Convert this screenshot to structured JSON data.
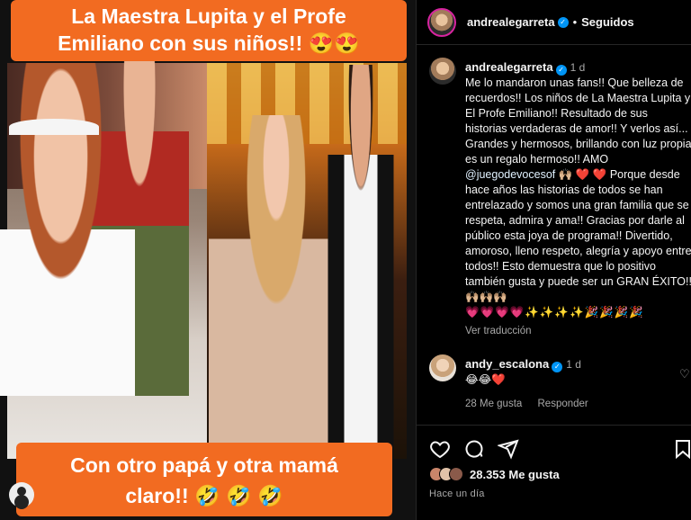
{
  "post_image": {
    "top_banner_line1": "La Maestra Lupita y el Profe",
    "top_banner_line2": "Emiliano con sus niños!! 😍😍",
    "bottom_banner_line1": "Con otro papá y otra mamá",
    "bottom_banner_line2": "claro!! 🤣 🤣 🤣"
  },
  "header": {
    "username": "andrealegarreta",
    "verified": "✓",
    "separator": "•",
    "follow_status": "Seguidos"
  },
  "caption": {
    "username": "andrealegarreta",
    "time": "1 d",
    "text_part1": "Me lo mandaron unas fans!! Que belleza de recuerdos!! Los niños de La Maestra Lupita y El Profe Emiliano!! Resultado de sus historias verdaderas de amor!! Y verlos así... Grandes y hermosos, brillando con luz propia es un regalo hermoso!! AMO ",
    "mention": "@juegodevocesof",
    "text_part2": " 🙌🏼 ❤️ ❤️ Porque desde hace años las historias de todos se han entrelazado y somos una gran familia que se respeta, admira y ama!! Gracias por darle al público esta joya de programa!! Divertido, amoroso, lleno respeto, alegría y apoyo entre todos!! Esto demuestra que lo positivo también gusta y puede ser un GRAN ÉXITO!! 🙌🏼🙌🏼🙌🏼",
    "emoji_line": "💗💗💗💗✨✨✨✨🎉🎉🎉🎉",
    "translate_label": "Ver traducción"
  },
  "comment": {
    "username": "andy_escalona",
    "time": "1 d",
    "text": "😂😂❤️",
    "likes": "28 Me gusta",
    "reply_label": "Responder"
  },
  "actions": {
    "like_icon": "heart-icon",
    "comment_icon": "comment-icon",
    "share_icon": "share-icon",
    "save_icon": "bookmark-icon",
    "likes_count": "28.353 Me gusta",
    "posted_ago": "Hace un día"
  },
  "colors": {
    "banner_orange": "#f26b21",
    "verified_blue": "#0095f6",
    "muted_text": "#a8a8a8"
  }
}
